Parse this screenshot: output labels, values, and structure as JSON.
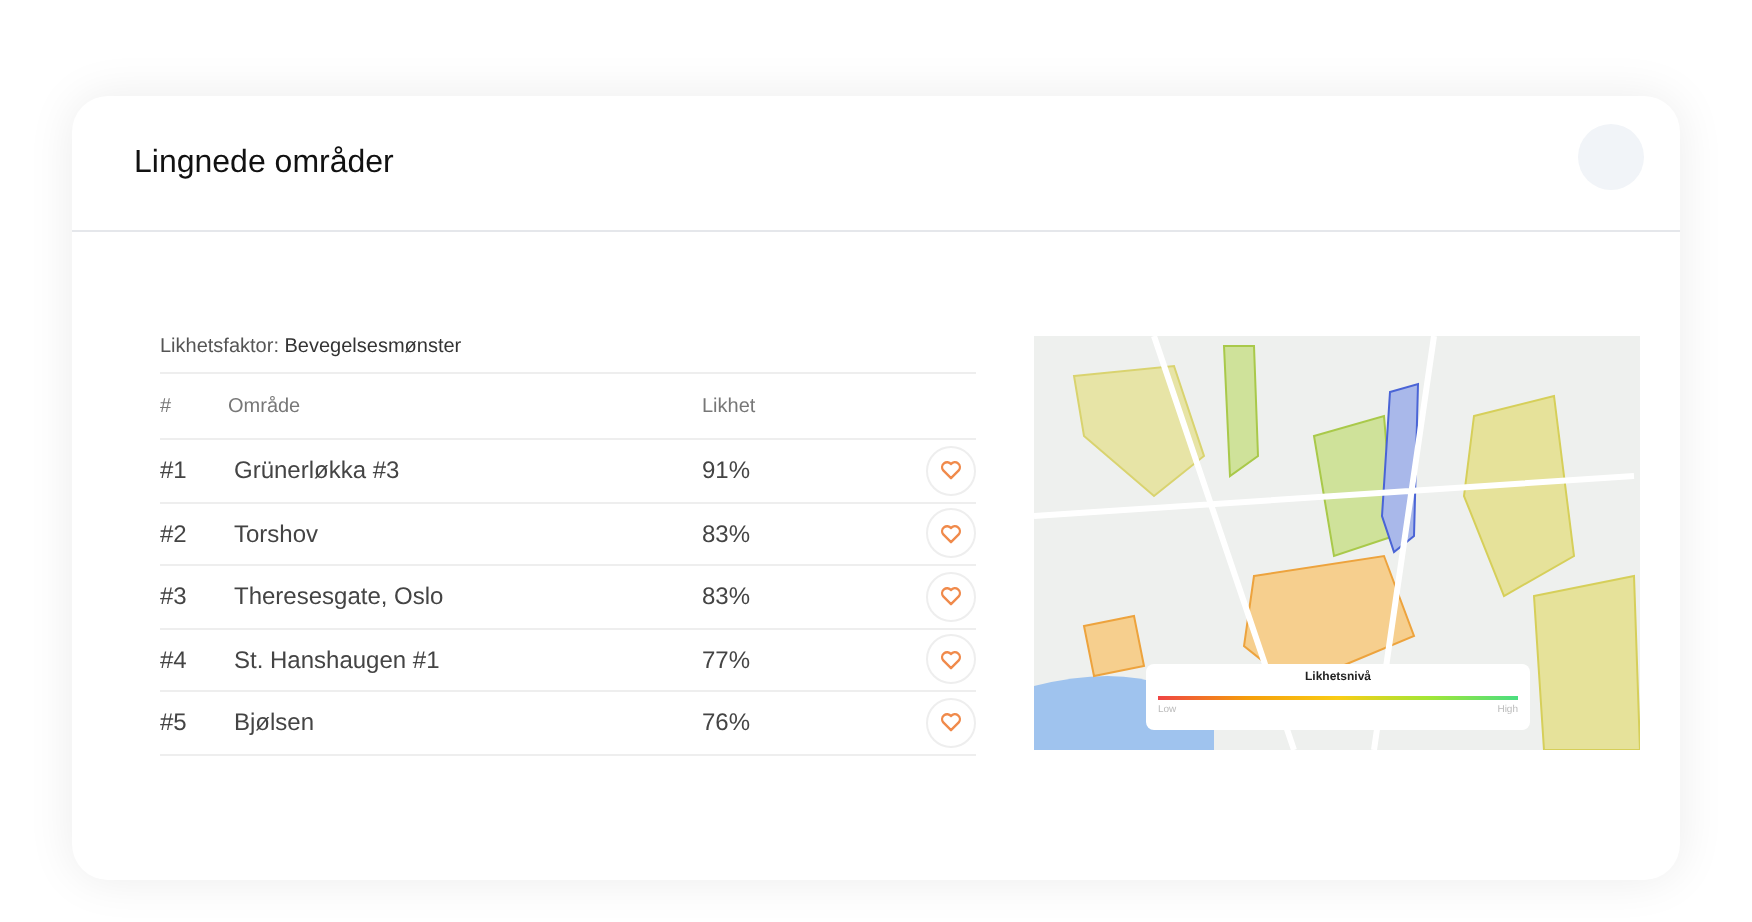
{
  "panel": {
    "title": "Lingnede områder"
  },
  "factor": {
    "label": "Likhetsfaktor:",
    "value": "Bevegelsesmønster"
  },
  "table": {
    "columns": [
      "#",
      "Område",
      "Likhet"
    ],
    "rows": [
      {
        "rank": "#1",
        "area": "Grünerløkka #3",
        "similarity": "91%"
      },
      {
        "rank": "#2",
        "area": "Torshov",
        "similarity": "83%"
      },
      {
        "rank": "#3",
        "area": "Theresesgate, Oslo",
        "similarity": "83%"
      },
      {
        "rank": "#4",
        "area": "St. Hanshaugen #1",
        "similarity": "77%"
      },
      {
        "rank": "#5",
        "area": "Bjølsen",
        "similarity": "76%"
      }
    ]
  },
  "legend": {
    "title": "Likhetsnivå",
    "low": "Low",
    "high": "High"
  }
}
